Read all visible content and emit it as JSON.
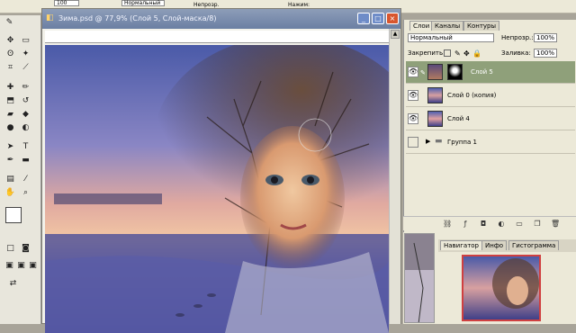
{
  "options_bar": {
    "field1": "100",
    "label1": "Нормальный",
    "label2": "Непрозр.",
    "label3": "Нажим:"
  },
  "document": {
    "title": "Зима.psd @ 77,9% (Слой 5, Слой-маска/8)",
    "minimize": "_",
    "maximize": "□",
    "close": "×"
  },
  "layers_palette": {
    "tabs": [
      "Слои",
      "Каналы",
      "Контуры"
    ],
    "blend_mode": "Нормальный",
    "opacity_label": "Непрозр.:",
    "opacity_value": "100%",
    "lock_label": "Закрепить:",
    "fill_label": "Заливка:",
    "fill_value": "100%",
    "layers": [
      {
        "name": "Слой 5",
        "selected": true
      },
      {
        "name": "Слой 0 (копия)",
        "selected": false
      },
      {
        "name": "Слой 4",
        "selected": false
      },
      {
        "name": "Группа 1",
        "selected": false
      }
    ]
  },
  "navigator_palette": {
    "tabs": [
      "Навигатор",
      "Инфо",
      "Гистограмма"
    ]
  },
  "colors": {
    "selected_layer": "#8fa07a",
    "nav_frame": "#d04040",
    "title_bar": "#6b7fa3"
  }
}
